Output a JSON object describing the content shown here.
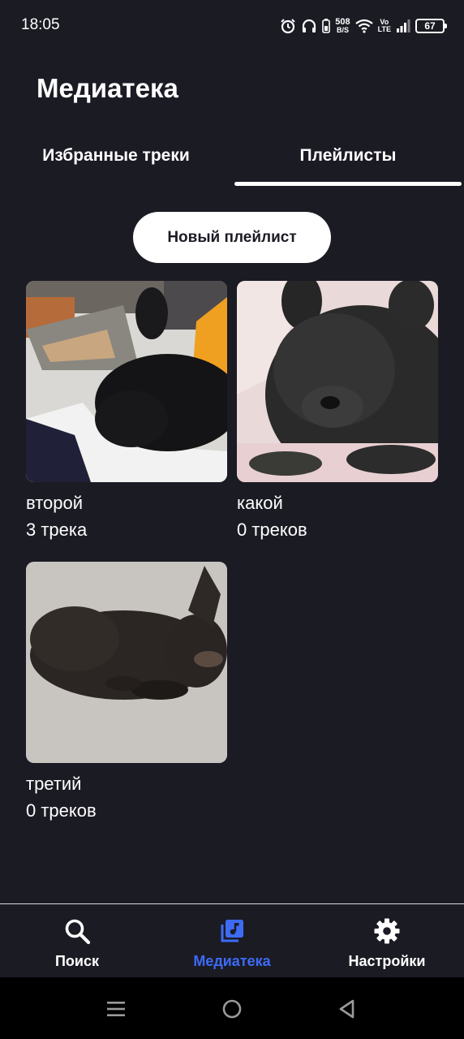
{
  "status_bar": {
    "time": "18:05",
    "net_speed_value": "508",
    "net_speed_unit": "B/S",
    "volte_top": "Vo",
    "volte_bottom": "LTE",
    "battery": "67"
  },
  "page": {
    "title": "Медиатека"
  },
  "tabs": [
    {
      "label": "Избранные треки",
      "active": false
    },
    {
      "label": "Плейлисты",
      "active": true
    }
  ],
  "new_playlist_button": "Новый плейлист",
  "playlists": [
    {
      "name": "второй",
      "count": "3 трека"
    },
    {
      "name": "какой",
      "count": "0 треков"
    },
    {
      "name": "третий",
      "count": "0 треков"
    }
  ],
  "bottom_nav": [
    {
      "label": "Поиск",
      "icon": "search-icon",
      "active": false
    },
    {
      "label": "Медиатека",
      "icon": "music-library-icon",
      "active": true
    },
    {
      "label": "Настройки",
      "icon": "gear-icon",
      "active": false
    }
  ],
  "system_nav": {
    "icons": [
      "menu-icon",
      "home-circle-icon",
      "back-triangle-icon"
    ]
  },
  "colors": {
    "background": "#1b1b24",
    "accent": "#3d6bf5",
    "text": "#ffffff"
  }
}
